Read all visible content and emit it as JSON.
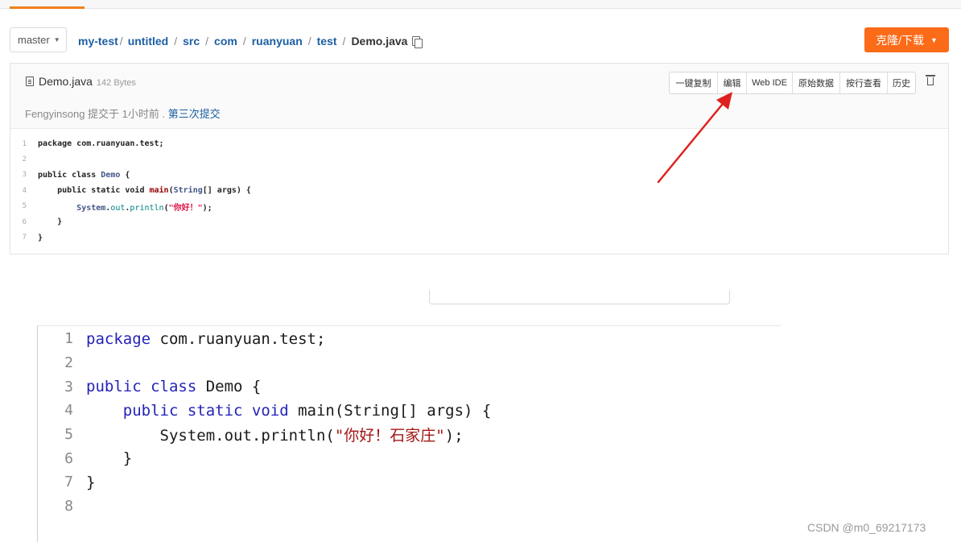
{
  "header": {
    "branch": "master",
    "breadcrumb": [
      "my-test",
      "untitled",
      "src",
      "com",
      "ruanyuan",
      "test"
    ],
    "current_file": "Demo.java",
    "clone_button": "克隆/下载"
  },
  "file": {
    "name": "Demo.java",
    "size": "142 Bytes",
    "actions": [
      "一键复制",
      "编辑",
      "Web IDE",
      "原始数据",
      "按行查看",
      "历史"
    ],
    "commit_author_text": "Fengyinsong 提交于 1小时前 .",
    "commit_message": "第三次提交"
  },
  "code_preview": {
    "line_numbers": [
      "1",
      "2",
      "3",
      "4",
      "5",
      "6",
      "7"
    ]
  },
  "editor": {
    "line_numbers": [
      "1",
      "2",
      "3",
      "4",
      "5",
      "6",
      "7",
      "8"
    ]
  },
  "watermark": "CSDN @m0_69217173",
  "colors": {
    "accent_orange": "#fb6b18",
    "link_blue": "#1d5fa3",
    "arrow_red": "#e02020"
  }
}
